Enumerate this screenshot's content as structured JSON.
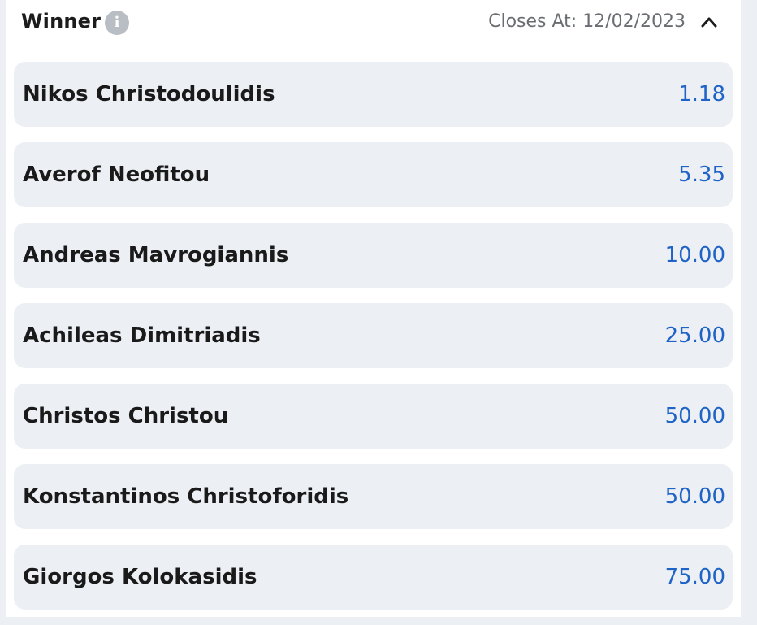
{
  "market": {
    "title": "Winner",
    "info_icon": "info-icon",
    "closes_text": "Closes At: 12/02/2023",
    "collapse_icon": "chevron-up-icon"
  },
  "colors": {
    "odds": "#1f63c7",
    "row_background": "#eceff3"
  },
  "selections": [
    {
      "name": "Nikos Christodoulidis",
      "odds": "1.18"
    },
    {
      "name": "Averof Neofitou",
      "odds": "5.35"
    },
    {
      "name": "Andreas Mavrogiannis",
      "odds": "10.00"
    },
    {
      "name": "Achileas Dimitriadis",
      "odds": "25.00"
    },
    {
      "name": "Christos Christou",
      "odds": "50.00"
    },
    {
      "name": "Konstantinos Christoforidis",
      "odds": "50.00"
    },
    {
      "name": "Giorgos Kolokasidis",
      "odds": "75.00"
    }
  ]
}
